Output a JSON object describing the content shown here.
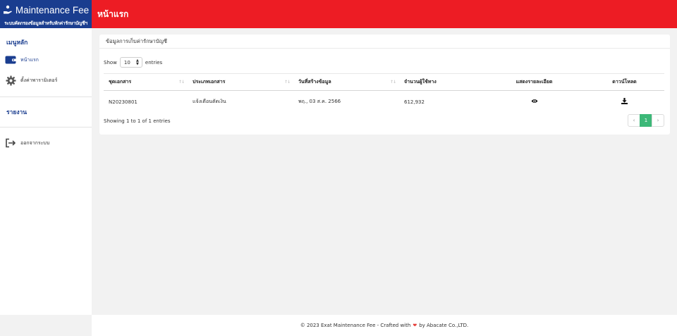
{
  "brand": {
    "title": "Maintenance Fee",
    "subtitle": "ระบบคัดกรองข้อมูลสำหรับหักค่ารักษาบัญชีฯ"
  },
  "header": {
    "title": "หน้าแรก"
  },
  "sidebar": {
    "main_menu_title": "เมนูหลัก",
    "items": [
      {
        "label": "หน้าแรก",
        "icon": "wallet-icon"
      },
      {
        "label": "ตั้งค่าพารามิเตอร์",
        "icon": "gear-icon"
      }
    ],
    "report_title": "รายงาน",
    "logout": {
      "label": "ออกจากระบบ",
      "icon": "logout-icon"
    }
  },
  "card": {
    "title": "ข้อมูลการเก็บค่ารักษาบัญชี",
    "length": {
      "show": "Show",
      "value": "10",
      "entries": "entries"
    },
    "table": {
      "columns": [
        "ชุดเอกสาร",
        "ประเภทเอกสาร",
        "วันที่สร้างข้อมูล",
        "จำนวนผู้ใช้ทาง",
        "แสดงรายละเอียด",
        "ดาวน์โหลด"
      ],
      "rows": [
        {
          "doc_set": "N20230801",
          "doc_type": "แจ้งเตือนตัดเงิน",
          "created": "พฤ., 03 ส.ค. 2566",
          "count": "612,932",
          "view_icon": "eye-icon",
          "download_icon": "download-icon"
        }
      ]
    },
    "info": "Showing 1 to 1 of 1 entries",
    "pagination": {
      "prev": "‹",
      "page": "1",
      "next": "›"
    }
  },
  "footer": {
    "prefix": "© 2023 Exat Maintenance Fee - Crafted with",
    "suffix": "by Abacate Co.,LTD."
  },
  "colors": {
    "brand": "#1a3d8f",
    "header": "#ed1c24",
    "active_page": "#3cb878"
  }
}
